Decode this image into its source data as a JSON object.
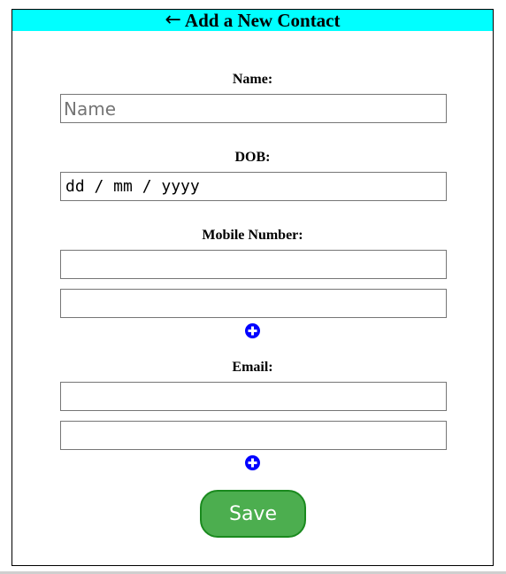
{
  "header": {
    "back_arrow": "←",
    "title": "Add a New Contact",
    "background_color": "#00ffff"
  },
  "form": {
    "name": {
      "label": "Name:",
      "placeholder": "Name"
    },
    "dob": {
      "label": "DOB:",
      "value": "dd / mm / yyyy"
    },
    "mobile": {
      "label": "Mobile Number:",
      "fields": [
        "",
        ""
      ],
      "add_icon": "plus-circle-icon"
    },
    "email": {
      "label": "Email:",
      "fields": [
        "",
        ""
      ],
      "add_icon": "plus-circle-icon"
    },
    "save_label": "Save"
  },
  "colors": {
    "add_icon": "#0000ff",
    "save_button": "#4cae4f",
    "save_border": "#1a8a1e"
  }
}
